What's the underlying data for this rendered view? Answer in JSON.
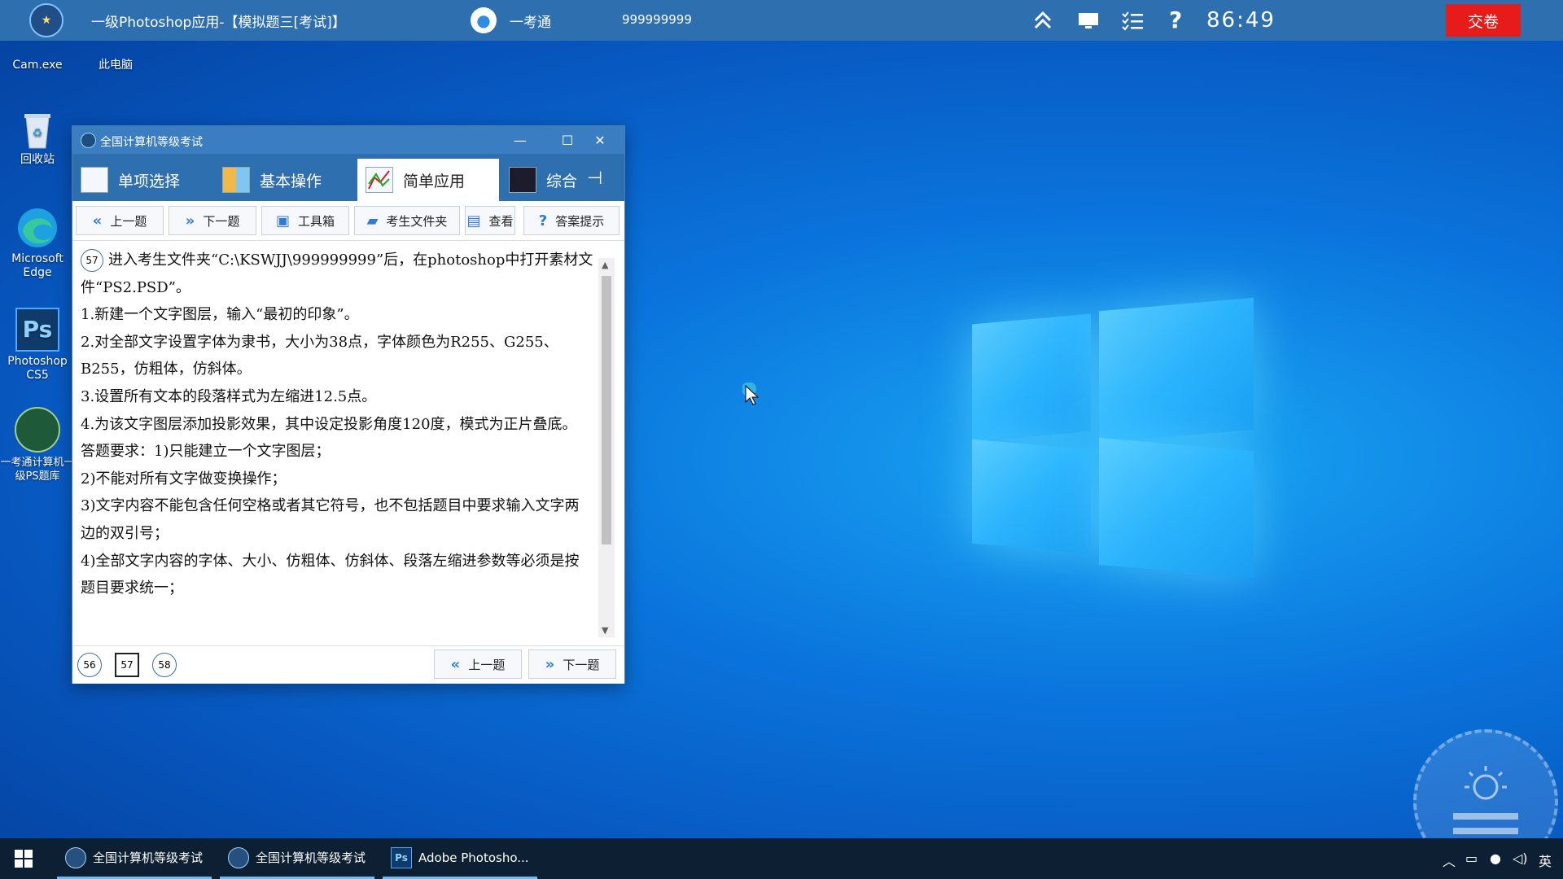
{
  "topbar": {
    "title": "一级Photoshop应用-【模拟题三[考试]】",
    "user": "一考通",
    "user_id": "999999999",
    "timer": "86:49",
    "submit_label": "交卷",
    "icons": [
      "collapse-up-icon",
      "screen-icon",
      "list-icon",
      "help-icon"
    ]
  },
  "desktop": {
    "icons": [
      {
        "label": "Cam.exe"
      },
      {
        "label": "此电脑"
      },
      {
        "label": "回收站"
      },
      {
        "label": "Microsoft Edge"
      },
      {
        "label": "Photoshop CS5"
      },
      {
        "label": "一考通计算机一级PS题库"
      }
    ]
  },
  "window": {
    "title": "全国计算机等级考试",
    "tabs": [
      {
        "label": "单项选择"
      },
      {
        "label": "基本操作"
      },
      {
        "label": "简单应用"
      },
      {
        "label": "综合"
      }
    ],
    "toolbar": {
      "prev": "上一题",
      "next": "下一题",
      "toolbox": "工具箱",
      "folder": "考生文件夹",
      "view": "查看",
      "hint": "答案提示"
    },
    "question": {
      "number": "57",
      "lines": [
        "进入考生文件夹“C:\\KSWJJ\\999999999”后，在photoshop中打开素材文件“PS2.PSD”。",
        "1.新建一个文字图层，输入“最初的印象”。",
        "2.对全部文字设置字体为隶书，大小为38点，字体颜色为R255、G255、B255，仿粗体，仿斜体。",
        "3.设置所有文本的段落样式为左缩进12.5点。",
        "4.为该文字图层添加投影效果，其中设定投影角度120度，模式为正片叠底。",
        "答题要求：1)只能建立一个文字图层；",
        "2)不能对所有文字做变换操作；",
        "3)文字内容不能包含任何空格或者其它符号，也不包括题目中要求输入文字两边的双引号；",
        "4)全部文字内容的字体、大小、仿粗体、仿斜体、段落左缩进参数等必须是按题目要求统一；"
      ]
    },
    "pages": [
      "56",
      "57",
      "58"
    ],
    "bottom": {
      "prev": "上一题",
      "next": "下一题"
    }
  },
  "taskbar": {
    "items": [
      {
        "label": "全国计算机等级考试"
      },
      {
        "label": "全国计算机等级考试"
      },
      {
        "label": "Adobe Photosho..."
      }
    ],
    "ime": "英"
  },
  "colors": {
    "submit": "#e81b1b",
    "titlebar": "#2e6fb0",
    "accent": "#2d7be0"
  }
}
